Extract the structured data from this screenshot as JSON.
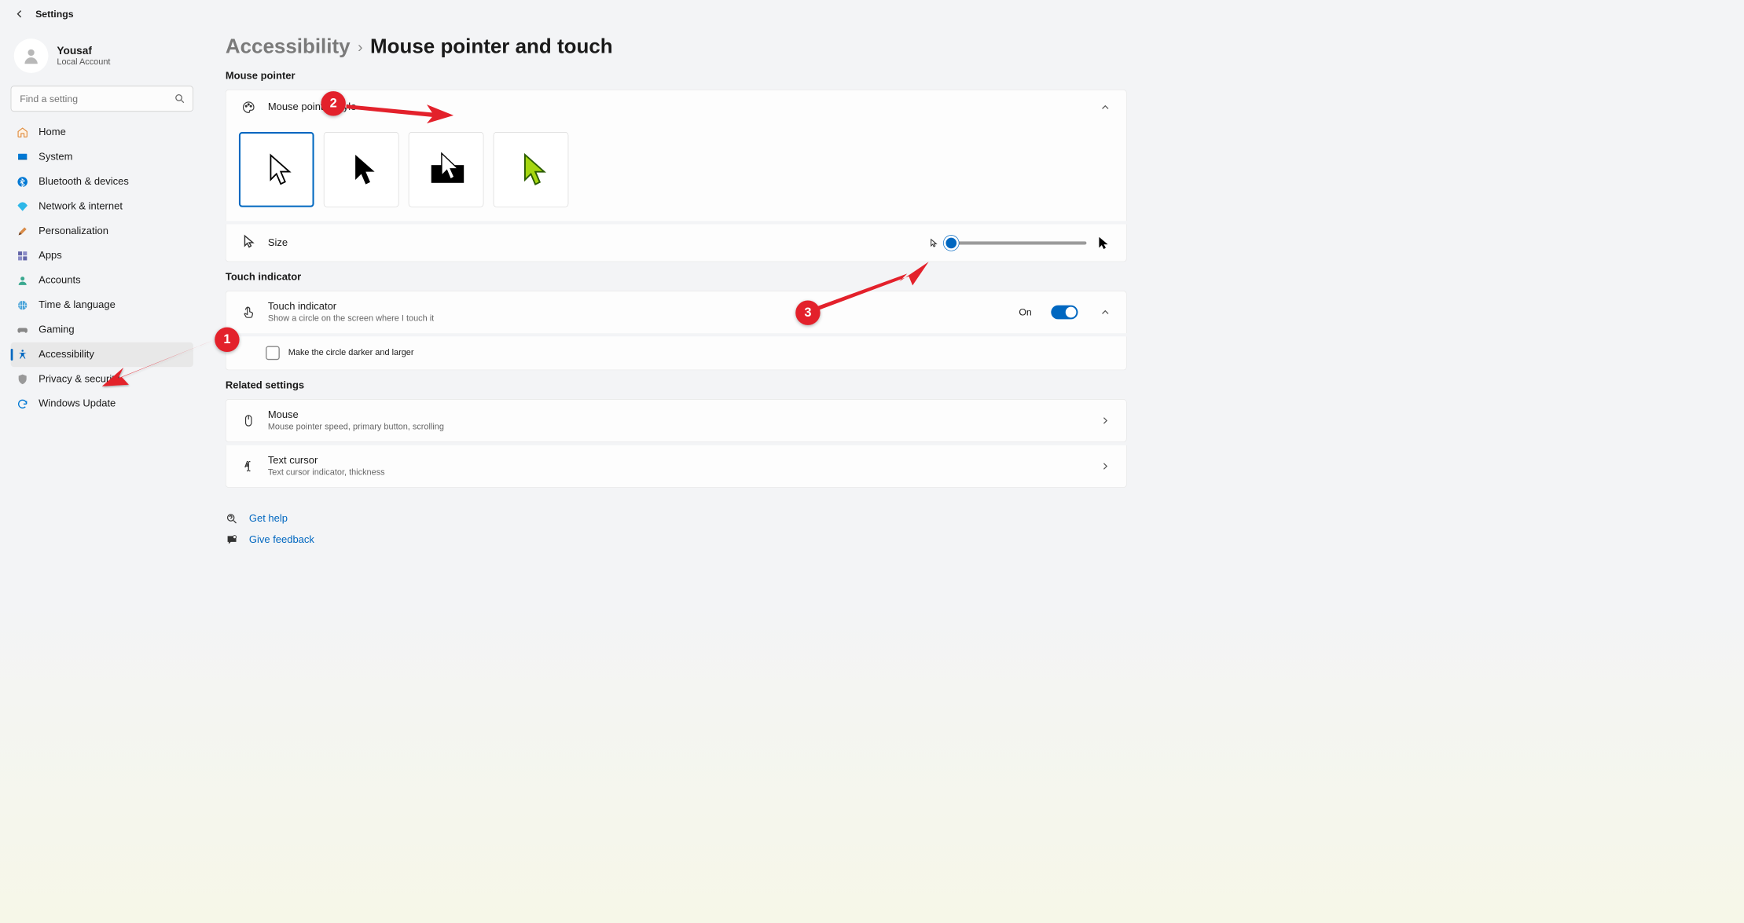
{
  "topbar": {
    "title": "Settings"
  },
  "user": {
    "name": "Yousaf",
    "sub": "Local Account"
  },
  "search": {
    "placeholder": "Find a setting"
  },
  "nav": {
    "items": [
      {
        "label": "Home"
      },
      {
        "label": "System"
      },
      {
        "label": "Bluetooth & devices"
      },
      {
        "label": "Network & internet"
      },
      {
        "label": "Personalization"
      },
      {
        "label": "Apps"
      },
      {
        "label": "Accounts"
      },
      {
        "label": "Time & language"
      },
      {
        "label": "Gaming"
      },
      {
        "label": "Accessibility"
      },
      {
        "label": "Privacy & security"
      },
      {
        "label": "Windows Update"
      }
    ]
  },
  "breadcrumb": {
    "parent": "Accessibility",
    "sep": "›",
    "current": "Mouse pointer and touch"
  },
  "sections": {
    "mouse_pointer": "Mouse pointer",
    "touch_indicator": "Touch indicator",
    "related": "Related settings"
  },
  "pointer_style": {
    "title": "Mouse pointer style",
    "options": [
      "white-outline",
      "black-solid",
      "inverted",
      "custom-color"
    ],
    "selected": "white-outline"
  },
  "size_row": {
    "label": "Size",
    "value_pct": 0
  },
  "touch": {
    "title": "Touch indicator",
    "sub": "Show a circle on the screen where I touch it",
    "state_label": "On",
    "on": true,
    "checkbox_label": "Make the circle darker and larger",
    "checked": false
  },
  "related": {
    "mouse": {
      "title": "Mouse",
      "sub": "Mouse pointer speed, primary button, scrolling"
    },
    "text_cursor": {
      "title": "Text cursor",
      "sub": "Text cursor indicator, thickness"
    }
  },
  "links": {
    "help": "Get help",
    "feedback": "Give feedback"
  },
  "annotations": {
    "badge1": "1",
    "badge2": "2",
    "badge3": "3"
  }
}
